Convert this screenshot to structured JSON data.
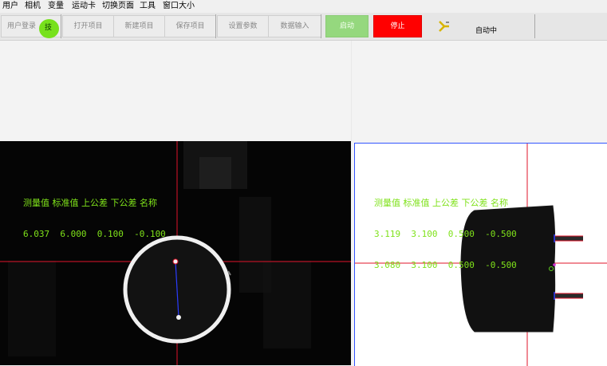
{
  "menu": [
    "用户",
    "相机",
    "变量",
    "运动卡",
    "切换页面",
    "工具",
    "窗口大小"
  ],
  "toolbar": {
    "login": "用户登录",
    "tech_badge": "技",
    "open_project": "打开项目",
    "new_project": "新建项目",
    "save_project": "保存项目",
    "settings": "设置参数",
    "data_input": "数据输入",
    "start": "启动",
    "stop": "停止",
    "status": "自动中"
  },
  "colors": {
    "start_green": "#95d87e",
    "stop_red": "#ff0000",
    "overlay_green": "#7fe21a",
    "crosshair_red": "#e0142a"
  },
  "left_camera": {
    "header": "测量值 标准值 上公差 下公差 名称",
    "rows": [
      "6.037  6.000  0.100  -0.100"
    ]
  },
  "right_camera": {
    "header": "测量值 标准值 上公差 下公差 名称",
    "rows": [
      "3.119  3.100  0.500  -0.500",
      "3.080  3.100  0.500  -0.500"
    ]
  }
}
